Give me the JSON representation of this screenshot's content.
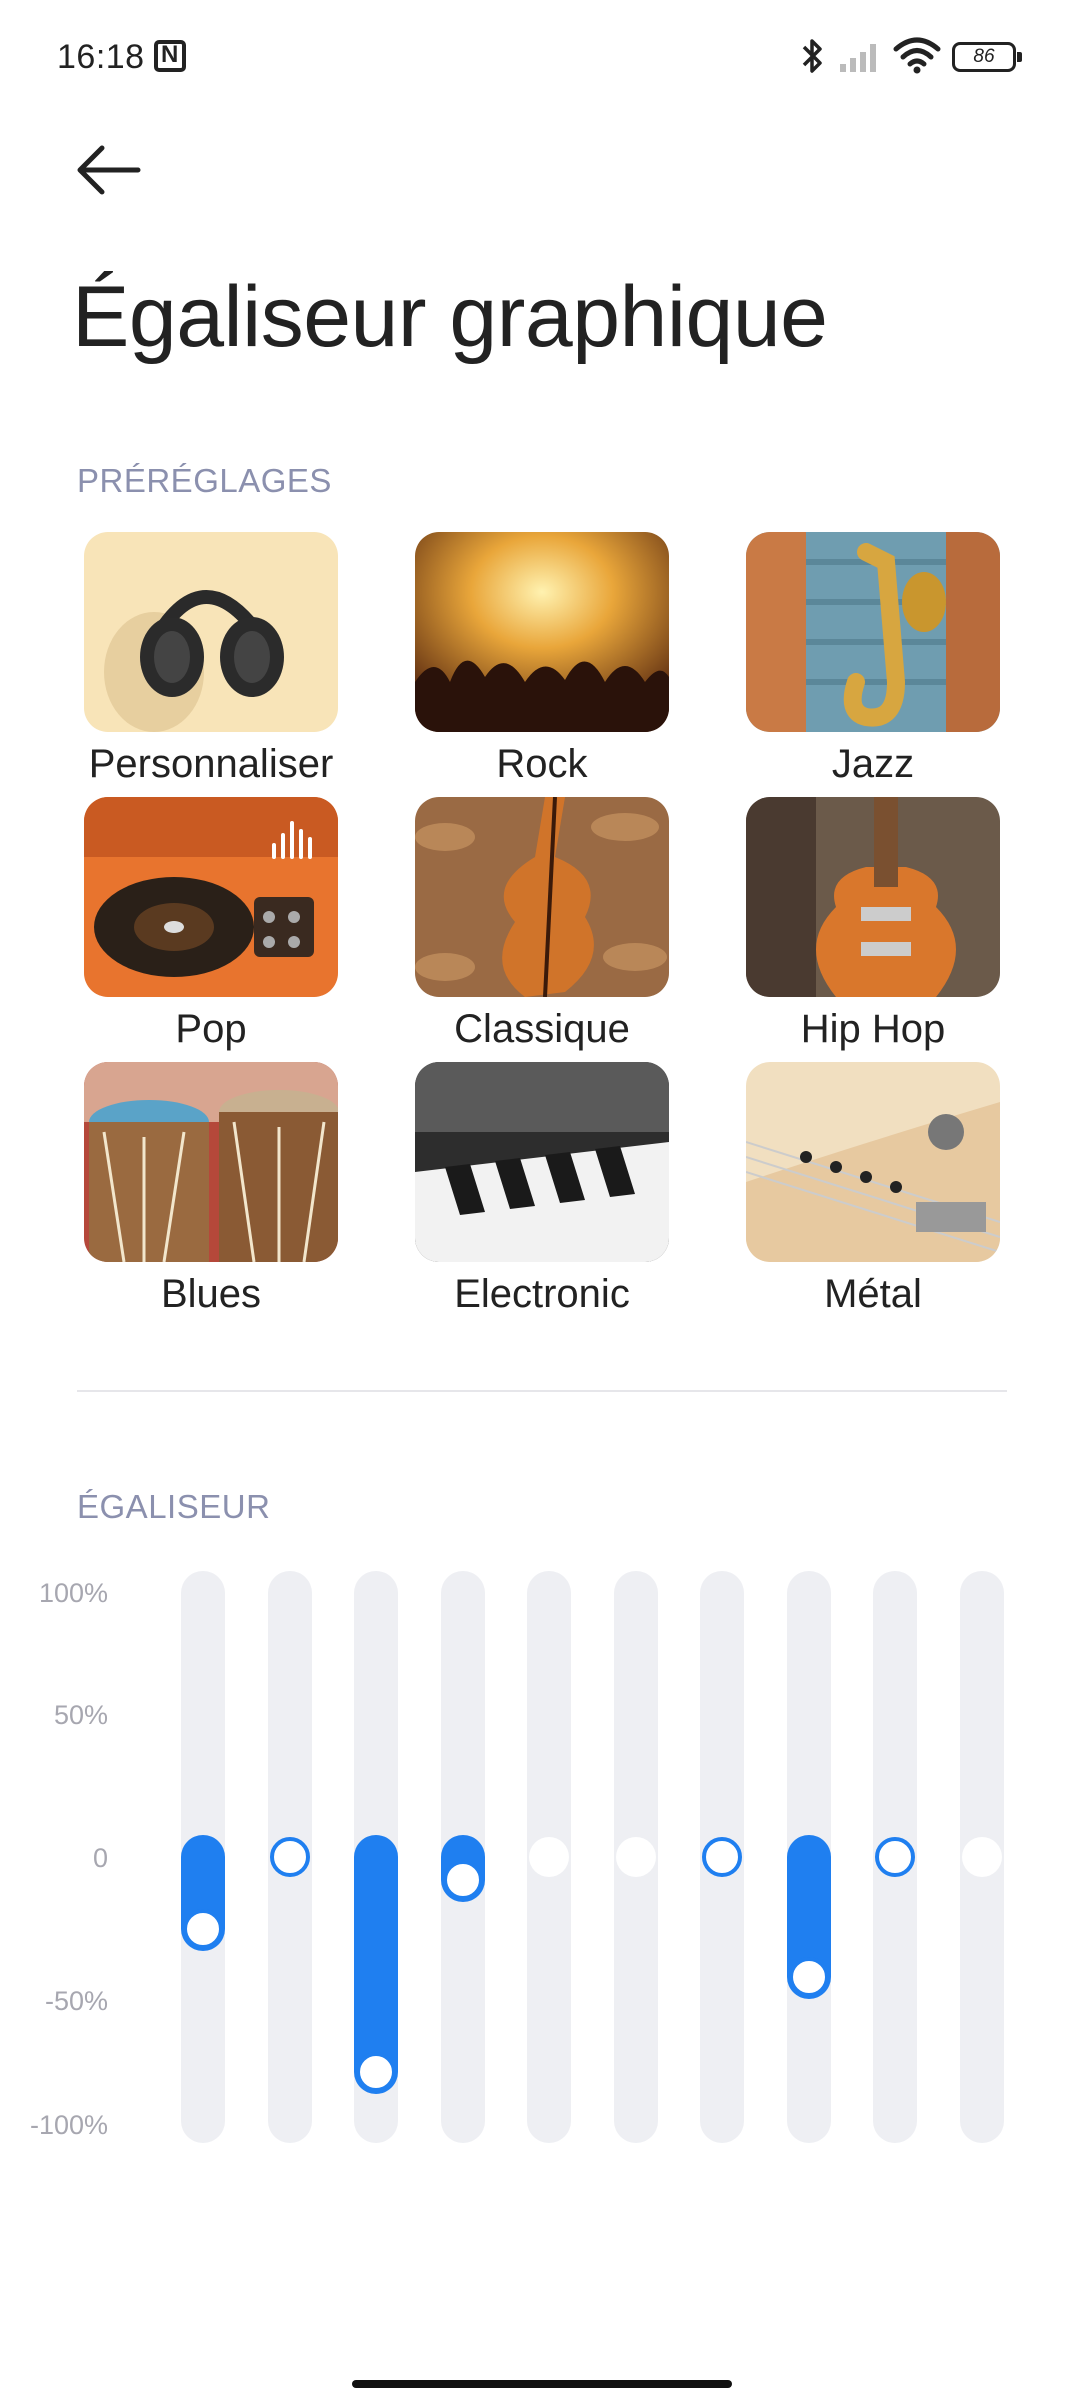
{
  "status_bar": {
    "time": "16:18",
    "battery": "86",
    "icons": [
      "nfc-icon",
      "bluetooth-icon",
      "signal-icon",
      "wifi-icon",
      "battery-icon"
    ]
  },
  "header": {
    "back_icon": "arrow-left-icon",
    "title": "Égaliseur graphique"
  },
  "presets": {
    "label": "PRÉRÉGLAGES",
    "items": [
      {
        "name": "Personnaliser",
        "selected": false
      },
      {
        "name": "Rock",
        "selected": false
      },
      {
        "name": "Jazz",
        "selected": false
      },
      {
        "name": "Pop",
        "selected": true
      },
      {
        "name": "Classique",
        "selected": false
      },
      {
        "name": "Hip Hop",
        "selected": false
      },
      {
        "name": "Blues",
        "selected": false
      },
      {
        "name": "Electronic",
        "selected": false
      },
      {
        "name": "Métal",
        "selected": false
      }
    ],
    "selected_color": "#1f7ff0"
  },
  "equalizer": {
    "label": "ÉGALISEUR",
    "y_labels": [
      "100%",
      "50%",
      "0",
      "-50%",
      "-100%"
    ],
    "bands_percent": [
      -25,
      0,
      -75,
      -8,
      0,
      0,
      0,
      -42,
      0,
      0
    ],
    "accent": "#1f7ff0"
  }
}
